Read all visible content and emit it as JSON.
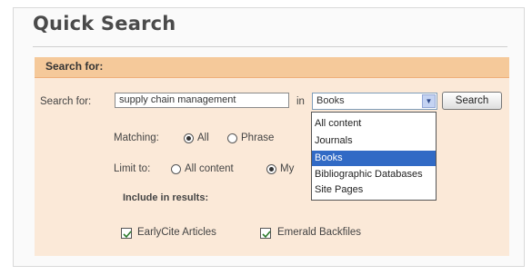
{
  "title": "Quick Search",
  "bar_label": "Search for:",
  "search": {
    "label": "Search for:",
    "query": "supply chain management",
    "in_label": "in",
    "selected": "Books",
    "button": "Search",
    "options": [
      "All content",
      "Journals",
      "Books",
      "Bibliographic Databases",
      "Site Pages"
    ],
    "selected_index": 2
  },
  "matching": {
    "label": "Matching:",
    "options": [
      "All",
      "Phrase"
    ],
    "selected_index": 0
  },
  "limit": {
    "label": "Limit to:",
    "options": [
      "All content",
      "My"
    ],
    "selected_index": 1
  },
  "include": {
    "label": "Include in results:",
    "options": [
      {
        "label": "EarlyCite Articles",
        "checked": true
      },
      {
        "label": "Emerald Backfiles",
        "checked": true
      }
    ]
  },
  "colors": {
    "accent_bar": "#f5c99a",
    "selected_option": "#316ac5"
  }
}
